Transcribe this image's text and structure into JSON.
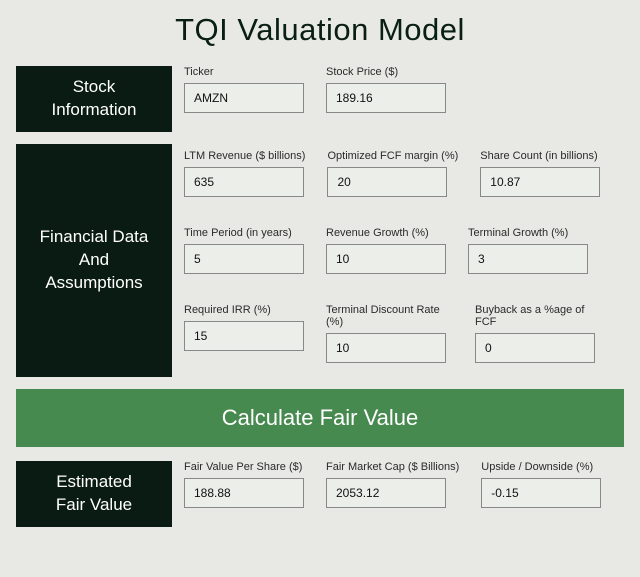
{
  "title": "TQI Valuation Model",
  "sections": {
    "stock": {
      "heading": "Stock Information",
      "fields": {
        "ticker": {
          "label": "Ticker",
          "value": "AMZN"
        },
        "price": {
          "label": "Stock Price ($)",
          "value": "189.16"
        }
      }
    },
    "financial": {
      "heading": "Financial Data And Assumptions",
      "fields": {
        "ltm_revenue": {
          "label": "LTM Revenue ($ billions)",
          "value": "635"
        },
        "fcf_margin": {
          "label": "Optimized FCF margin (%)",
          "value": "20"
        },
        "share_count": {
          "label": "Share Count (in billions)",
          "value": "10.87"
        },
        "time_period": {
          "label": "Time Period (in years)",
          "value": "5"
        },
        "rev_growth": {
          "label": "Revenue Growth (%)",
          "value": "10"
        },
        "term_growth": {
          "label": "Terminal Growth (%)",
          "value": "3"
        },
        "req_irr": {
          "label": "Required IRR (%)",
          "value": "15"
        },
        "term_discount": {
          "label": "Terminal Discount Rate (%)",
          "value": "10"
        },
        "buyback": {
          "label": "Buyback as a %age of FCF",
          "value": "0"
        }
      }
    },
    "estimated": {
      "heading": "Estimated Fair Value",
      "fields": {
        "fv_per_share": {
          "label": "Fair Value Per Share ($)",
          "value": "188.88"
        },
        "fv_mkt_cap": {
          "label": "Fair Market Cap ($ Billions)",
          "value": "2053.12"
        },
        "upside": {
          "label": "Upside / Downside (%)",
          "value": "-0.15"
        }
      }
    }
  },
  "calculate_label": "Calculate Fair Value"
}
